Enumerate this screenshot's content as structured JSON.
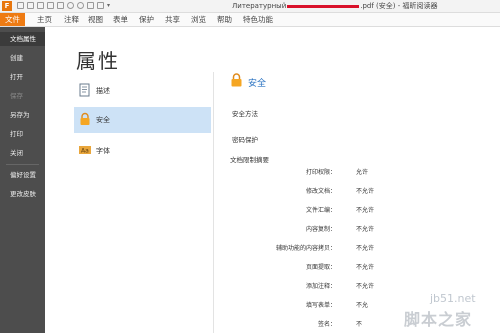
{
  "titlebar": {
    "title_prefix": "Литературный",
    "title_suffix": ".pdf (安全) - 福昕阅读器"
  },
  "menubar": [
    "文件",
    "主页",
    "注释",
    "视图",
    "表单",
    "保护",
    "共享",
    "浏览",
    "帮助",
    "特色功能"
  ],
  "sidebar": {
    "items": [
      "文档属性",
      "创建",
      "打开",
      "保存",
      "另存为",
      "打印",
      "关闭",
      "偏好设置",
      "更改皮肤"
    ],
    "active_index": 0,
    "disabled_index": 3
  },
  "main": {
    "title": "属性",
    "categories": [
      "描述",
      "安全",
      "字体"
    ],
    "active_category": 1,
    "section_title": "安全",
    "security_method_label": "安全方法",
    "password_protect_label": "密码保护",
    "restrictions_label": "文档限制摘要",
    "restrictions": [
      {
        "label": "打印权限：",
        "value": "允许"
      },
      {
        "label": "修改文档：",
        "value": "不允许"
      },
      {
        "label": "文件汇编：",
        "value": "不允许"
      },
      {
        "label": "内容复制：",
        "value": "不允许"
      },
      {
        "label": "辅助功能的内容拷贝：",
        "value": "不允许"
      },
      {
        "label": "页面提取：",
        "value": "不允许"
      },
      {
        "label": "添加注释：",
        "value": "不允许"
      },
      {
        "label": "填写表单：",
        "value": "不允"
      },
      {
        "label": "签名：",
        "value": "不"
      }
    ]
  },
  "watermark": {
    "url": "jb51.net",
    "text": "脚本之家"
  },
  "colors": {
    "accent": "#ee7b13",
    "sidebar": "#4d4d4d",
    "selected": "#cde2f6",
    "title_blue": "#2a73c2"
  }
}
